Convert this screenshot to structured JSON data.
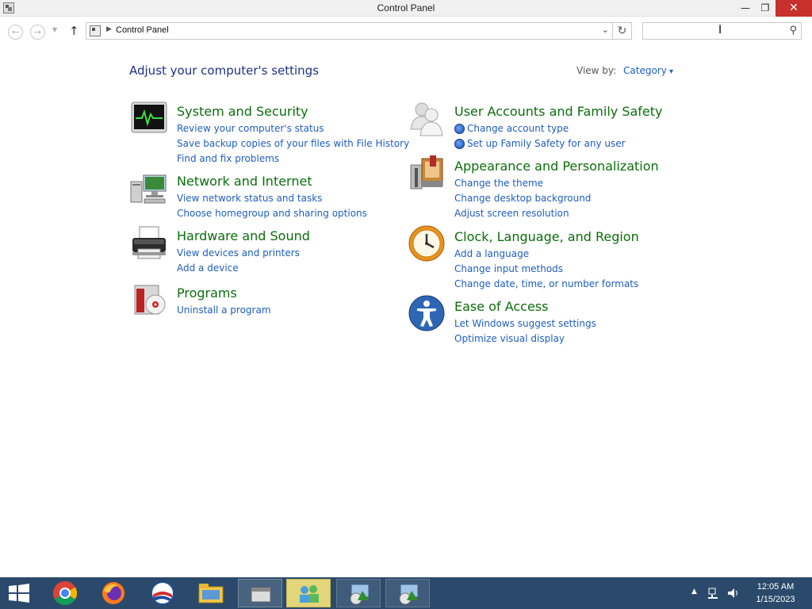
{
  "window": {
    "title": "Control Panel",
    "buttons": {
      "minimize": "—",
      "maximize": "❐",
      "close": "✕"
    }
  },
  "nav": {
    "breadcrumb": "Control Panel",
    "search_placeholder": ""
  },
  "header": {
    "title": "Adjust your computer's settings",
    "view_by_label": "View by:",
    "view_by_value": "Category"
  },
  "categories": [
    {
      "name": "System and Security",
      "icon": "system-security-icon",
      "links": [
        "Review your computer's status",
        "Save backup copies of your files with File History",
        "Find and fix problems"
      ]
    },
    {
      "name": "Network and Internet",
      "icon": "network-icon",
      "links": [
        "View network status and tasks",
        "Choose homegroup and sharing options"
      ]
    },
    {
      "name": "Hardware and Sound",
      "icon": "printer-icon",
      "links": [
        "View devices and printers",
        "Add a device"
      ]
    },
    {
      "name": "Programs",
      "icon": "programs-icon",
      "links": [
        "Uninstall a program"
      ]
    },
    {
      "name": "User Accounts and Family Safety",
      "icon": "users-icon",
      "links": [
        "Change account type",
        "Set up Family Safety for any user"
      ]
    },
    {
      "name": "Appearance and Personalization",
      "icon": "appearance-icon",
      "links": [
        "Change the theme",
        "Change desktop background",
        "Adjust screen resolution"
      ]
    },
    {
      "name": "Clock, Language, and Region",
      "icon": "clock-icon",
      "links": [
        "Add a language",
        "Change input methods",
        "Change date, time, or number formats"
      ]
    },
    {
      "name": "Ease of Access",
      "icon": "accessibility-icon",
      "links": [
        "Let Windows suggest settings",
        "Optimize visual display"
      ]
    }
  ],
  "taskbar": {
    "apps": [
      "start-icon",
      "chrome-icon",
      "firefox-icon",
      "obama-icon",
      "file-explorer-icon",
      "app-icon",
      "control-panel-icon",
      "installer-icon",
      "installer-icon"
    ],
    "clock_time": "12:05 AM",
    "clock_date": "1/15/2023"
  }
}
